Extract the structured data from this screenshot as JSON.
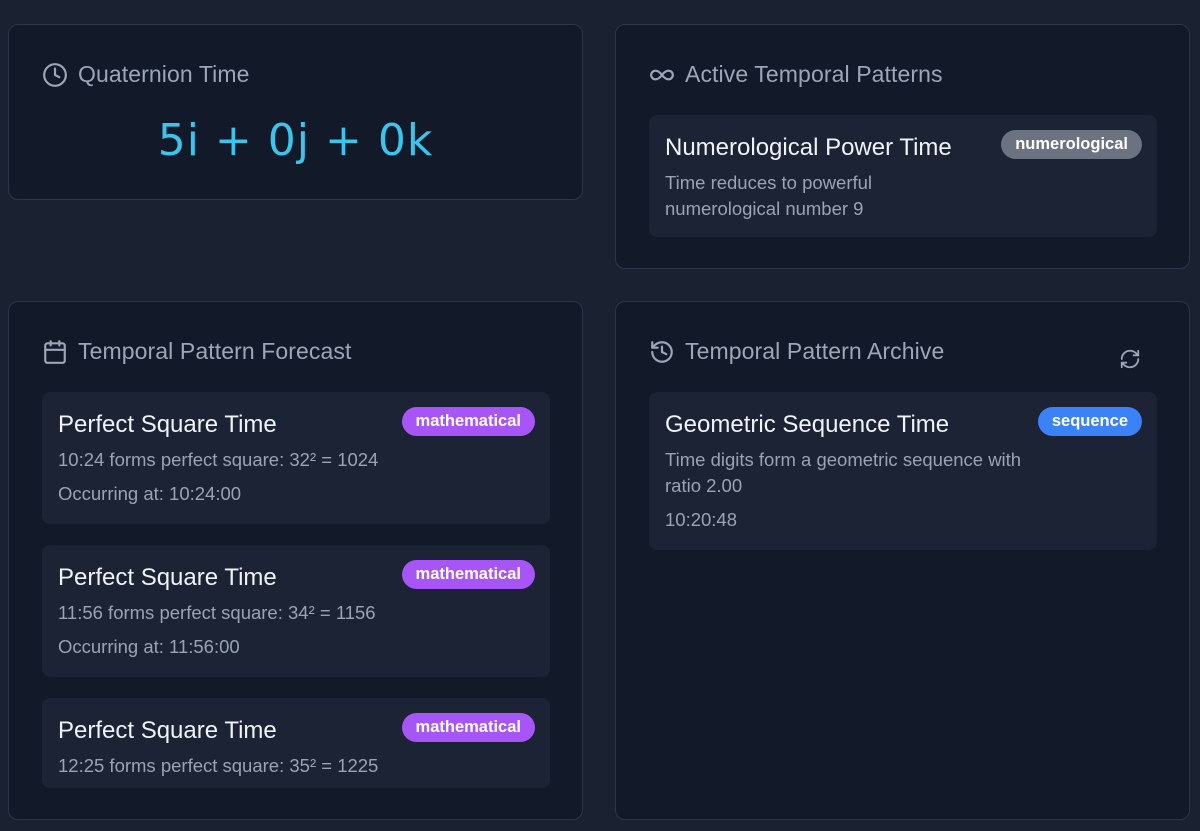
{
  "quaternion_time": {
    "title": "Quaternion Time",
    "value": "5i + 0j + 0k"
  },
  "active_patterns": {
    "title": "Active Temporal Patterns",
    "items": [
      {
        "title": "Numerological Power Time",
        "badge": "numerological",
        "badge_color": "#6b7280",
        "description": "Time reduces to powerful numerological number 9"
      }
    ]
  },
  "forecast": {
    "title": "Temporal Pattern Forecast",
    "items": [
      {
        "title": "Perfect Square Time",
        "badge": "mathematical",
        "badge_color": "#a855f7",
        "description": "10:24 forms perfect square: 32² = 1024",
        "time": "Occurring at: 10:24:00"
      },
      {
        "title": "Perfect Square Time",
        "badge": "mathematical",
        "badge_color": "#a855f7",
        "description": "11:56 forms perfect square: 34² = 1156",
        "time": "Occurring at: 11:56:00"
      },
      {
        "title": "Perfect Square Time",
        "badge": "mathematical",
        "badge_color": "#a855f7",
        "description": "12:25 forms perfect square: 35² = 1225"
      }
    ]
  },
  "archive": {
    "title": "Temporal Pattern Archive",
    "refresh_icon": "refresh-icon",
    "items": [
      {
        "title": "Geometric Sequence Time",
        "badge": "sequence",
        "badge_color": "#3b82f6",
        "description": "Time digits form a geometric sequence with ratio 2.00",
        "time": "10:20:48"
      }
    ]
  },
  "colors": {
    "accent_cyan": "#3bc4ec",
    "background": "#1a2232",
    "card": "#121a29"
  }
}
